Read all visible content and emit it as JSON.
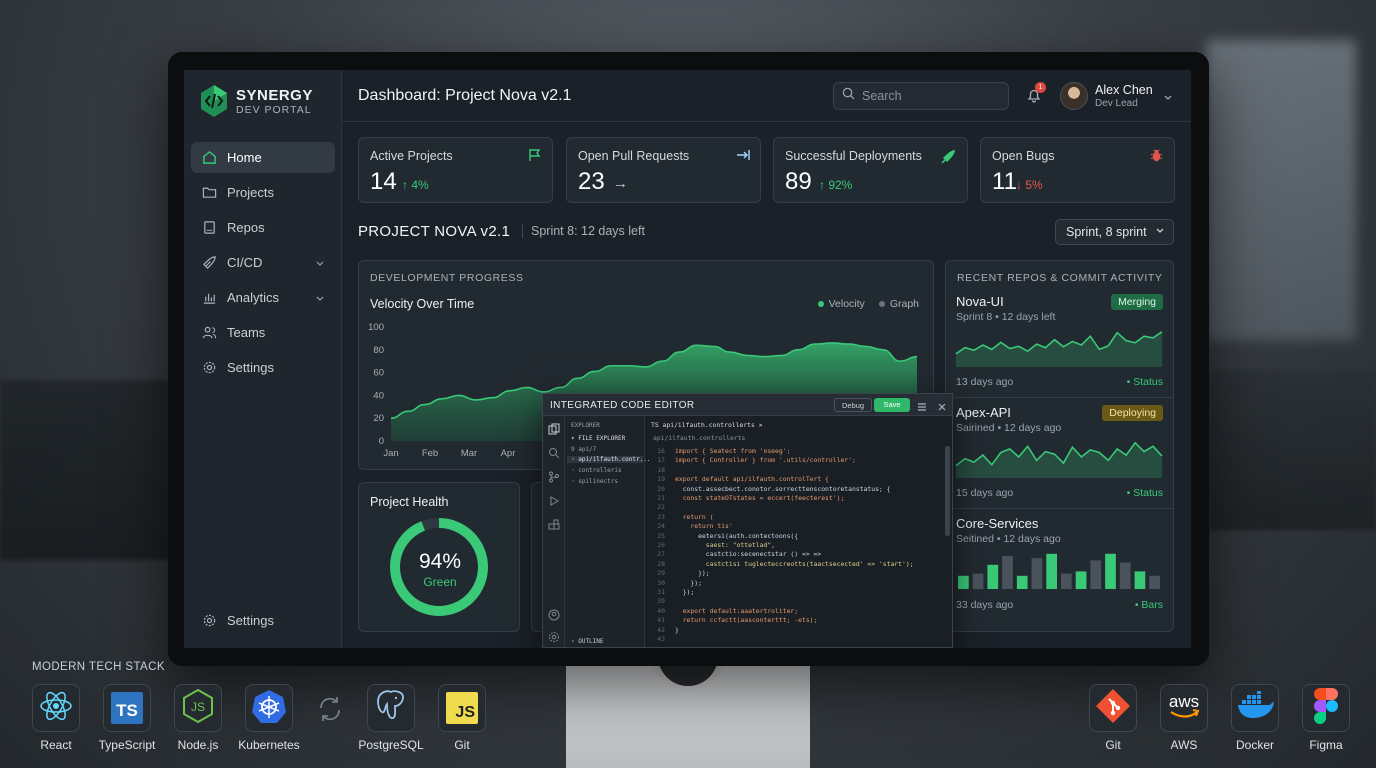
{
  "app": {
    "logo_title": "SYNERGY",
    "logo_sub": "DEV PORTAL",
    "page_title": "Dashboard: Project Nova v2.1",
    "brand_color": "#39c977"
  },
  "sidebar": {
    "items": [
      {
        "label": "Home",
        "icon": "home-icon",
        "active": true
      },
      {
        "label": "Projects",
        "icon": "folder-icon"
      },
      {
        "label": "Repos",
        "icon": "repo-icon"
      },
      {
        "label": "CI/CD",
        "icon": "rocket-icon",
        "expandable": true
      },
      {
        "label": "Analytics",
        "icon": "bar-chart-icon",
        "expandable": true
      },
      {
        "label": "Teams",
        "icon": "users-icon"
      },
      {
        "label": "Settings",
        "icon": "gear-icon"
      }
    ],
    "bottom_label": "Settings"
  },
  "header": {
    "search_placeholder": "Search",
    "notification_count": "1",
    "user_name": "Alex Chen",
    "user_role": "Dev Lead"
  },
  "stats": [
    {
      "label": "Active Projects",
      "value": "14",
      "delta": "↑ 4%",
      "trend": "up",
      "icon": "flag-icon"
    },
    {
      "label": "Open Pull Requests",
      "value": "23",
      "delta": "→",
      "trend": "flat",
      "icon": "pull-request-icon"
    },
    {
      "label": "Successful Deployments",
      "value": "89",
      "delta": "↑ 92%",
      "trend": "up",
      "icon": "rocket-icon"
    },
    {
      "label": "Open Bugs",
      "value": "11",
      "delta": "↓ 5%",
      "trend": "down",
      "icon": "bug-icon"
    }
  ],
  "project": {
    "title": "PROJECT NOVA v2.1",
    "sprint_text": "Sprint 8: 12 days left",
    "sprint_select": "Sprint, 8 sprint"
  },
  "dev_progress": {
    "caption": "DEVELOPMENT PROGRESS",
    "title": "Velocity Over Time",
    "legend": [
      "Velocity",
      "Graph"
    ]
  },
  "chart_data": {
    "type": "area",
    "title": "Velocity Over Time",
    "xlabel": "",
    "ylabel": "",
    "x": [
      "Jan",
      "Feb",
      "Mar",
      "Apr"
    ],
    "series": [
      {
        "name": "Velocity",
        "points": [
          [
            0,
            20
          ],
          [
            0.3,
            26
          ],
          [
            0.6,
            32
          ],
          [
            0.9,
            37
          ],
          [
            1.2,
            40
          ],
          [
            1.5,
            36
          ],
          [
            1.8,
            38
          ],
          [
            2.1,
            44
          ],
          [
            2.4,
            47
          ],
          [
            2.7,
            43
          ],
          [
            3.0,
            47
          ],
          [
            3.3,
            55
          ],
          [
            3.6,
            61
          ],
          [
            3.9,
            66
          ],
          [
            4.2,
            66
          ],
          [
            4.5,
            65
          ],
          [
            4.8,
            70
          ],
          [
            5.1,
            78
          ],
          [
            5.4,
            84
          ],
          [
            5.7,
            83
          ],
          [
            6.0,
            78
          ],
          [
            6.3,
            75
          ],
          [
            6.6,
            74
          ],
          [
            6.9,
            75
          ],
          [
            7.2,
            80
          ],
          [
            7.5,
            85
          ],
          [
            7.8,
            86
          ],
          [
            8.1,
            85
          ],
          [
            8.4,
            83
          ],
          [
            8.7,
            80
          ],
          [
            9.0,
            70
          ],
          [
            9.3,
            74
          ]
        ]
      }
    ],
    "ylim": [
      0,
      100
    ],
    "yticks": [
      0,
      20,
      40,
      60,
      80,
      100
    ],
    "grid": false,
    "legend_position": "top-right"
  },
  "health": {
    "title": "Project Health",
    "percent": "94%",
    "label": "Green",
    "value": 0.94
  },
  "repos": {
    "caption": "RECENT REPOS & COMMIT ACTIVITY",
    "items": [
      {
        "name": "Nova-UI",
        "sub": "Sprint 8 • 12 days left",
        "badge": "Merging",
        "badge_color": "#39c977",
        "foot": "13 days ago",
        "status": "• Status",
        "kind": "line",
        "values": [
          30,
          44,
          38,
          50,
          40,
          56,
          42,
          47,
          36,
          52,
          44,
          62,
          46,
          58,
          50,
          70,
          40,
          48,
          78,
          60,
          55,
          70,
          66,
          80
        ]
      },
      {
        "name": "Apex-API",
        "sub": "Sairined • 12 days ago",
        "badge": "Deploying",
        "badge_color": "#d0a41c",
        "foot": "15 days ago",
        "status": "• Status",
        "kind": "line",
        "values": [
          28,
          44,
          36,
          52,
          30,
          58,
          66,
          48,
          72,
          40,
          60,
          54,
          34,
          70,
          48,
          64,
          58,
          40,
          66,
          52,
          80,
          60,
          72,
          50
        ]
      },
      {
        "name": "Core-Services",
        "sub": "Seitined • 12 days ago",
        "badge": "",
        "foot": "33 days ago",
        "status": "• Bars",
        "kind": "bar",
        "values": [
          30,
          35,
          55,
          75,
          30,
          70,
          80,
          35,
          40,
          65,
          80,
          60,
          40,
          30
        ]
      }
    ]
  },
  "editor": {
    "title": "INTEGRATED CODE EDITOR",
    "debug": "Debug",
    "save": "Save",
    "tab": "TS  api/ilfauth.controllerts  ✕",
    "path": "api/ilfauth.controllerts",
    "tree": [
      "EXPLORER",
      "▾ FILE EXPLORER",
      "  9  api/7",
      "  ◦ api/ilfauth.contr...",
      "  ◦ controlleris",
      "  ◦ spilinectrs",
      "› OUTLINE"
    ],
    "lines": [
      {
        "n": "16",
        "t": "import { Seatect from 'oseeg';"
      },
      {
        "n": "17",
        "t": "import { Controller } from '.utils/controller';"
      },
      {
        "n": "18",
        "t": ""
      },
      {
        "n": "19",
        "t": "export default api/ilfauth.controlTert {"
      },
      {
        "n": "20",
        "t": "  const.assecbect.conotor.sorrecttenscontoretanstatus; {"
      },
      {
        "n": "21",
        "t": "  const stateOTstates = eccert(feecterest');"
      },
      {
        "n": "22",
        "t": ""
      },
      {
        "n": "23",
        "t": "  return ("
      },
      {
        "n": "24",
        "t": "    return tis'"
      },
      {
        "n": "25",
        "t": "      eetersi(auth.contectoons({"
      },
      {
        "n": "26",
        "t": "        saest: \"ottetlad\","
      },
      {
        "n": "27",
        "t": "        castctio:secenectstar () => =>"
      },
      {
        "n": "28",
        "t": "        castctisi tuglecteccreotts(taactsecected' => 'start');"
      },
      {
        "n": "29",
        "t": "      });"
      },
      {
        "n": "30",
        "t": "    });"
      },
      {
        "n": "31",
        "t": "  });"
      },
      {
        "n": "39",
        "t": ""
      },
      {
        "n": "40",
        "t": "  export default:aaatertroliter;"
      },
      {
        "n": "41",
        "t": "  return ccfactt(aasconterttt; -ets);"
      },
      {
        "n": "42",
        "t": "}"
      },
      {
        "n": "43",
        "t": ""
      }
    ]
  },
  "tech_stack": {
    "caption": "MODERN TECH STACK",
    "left": [
      {
        "label": "React",
        "icon": "react-icon"
      },
      {
        "label": "TypeScript",
        "icon": "typescript-icon"
      },
      {
        "label": "Node.js",
        "icon": "nodejs-icon"
      },
      {
        "label": "Kubernetes",
        "icon": "kubernetes-icon"
      },
      {
        "label": "",
        "icon": "sync-icon"
      },
      {
        "label": "PostgreSQL",
        "icon": "postgresql-icon"
      },
      {
        "label": "Git",
        "icon": "javascript-icon"
      }
    ],
    "right": [
      {
        "label": "Git",
        "icon": "git-icon"
      },
      {
        "label": "AWS",
        "icon": "aws-icon"
      },
      {
        "label": "Docker",
        "icon": "docker-icon"
      },
      {
        "label": "Figma",
        "icon": "figma-icon"
      }
    ]
  }
}
